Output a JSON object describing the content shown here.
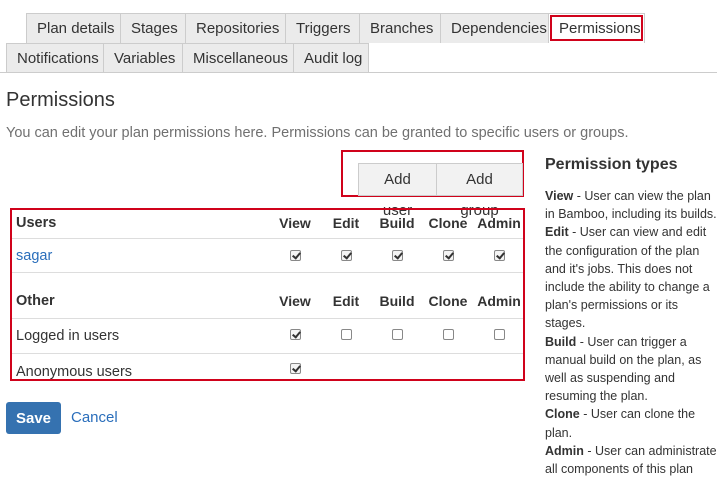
{
  "tabs_row1": [
    "Plan details",
    "Stages",
    "Repositories",
    "Triggers",
    "Branches",
    "Dependencies",
    "Permissions"
  ],
  "tabs_row2": [
    "Notifications",
    "Variables",
    "Miscellaneous",
    "Audit log"
  ],
  "page": {
    "title": "Permissions",
    "intro": "You can edit your plan permissions here. Permissions can be granted to specific users or groups."
  },
  "buttons": {
    "add_user": "Add user",
    "add_group": "Add group"
  },
  "columns": [
    "View",
    "Edit",
    "Build",
    "Clone",
    "Admin"
  ],
  "users_section": {
    "header": "Users",
    "rows": [
      {
        "name": "sagar",
        "perms": [
          true,
          true,
          true,
          true,
          true
        ]
      }
    ]
  },
  "other_section": {
    "header": "Other",
    "rows": [
      {
        "name": "Logged in users",
        "perms": [
          true,
          false,
          false,
          false,
          false
        ]
      },
      {
        "name": "Anonymous users",
        "perms": [
          true
        ]
      }
    ]
  },
  "actions": {
    "save": "Save",
    "cancel": "Cancel"
  },
  "sidebar": {
    "title": "Permission types",
    "items": [
      {
        "term": "View",
        "text": " - User can view the plan in Bamboo, including its builds."
      },
      {
        "term": "Edit",
        "text": " - User can view and edit the configuration of the plan and it's jobs. This does not include the ability to change a plan's permissions or its stages."
      },
      {
        "term": "Build",
        "text": " - User can trigger a manual build on the plan, as well as suspending and resuming the plan."
      },
      {
        "term": "Clone",
        "text": " - User can clone the plan."
      },
      {
        "term": "Admin",
        "text": " - User can administrate all components of this plan"
      }
    ]
  },
  "colors": {
    "accent": "#3572b0",
    "link": "#2a6ebb",
    "highlight": "#d0021b"
  }
}
